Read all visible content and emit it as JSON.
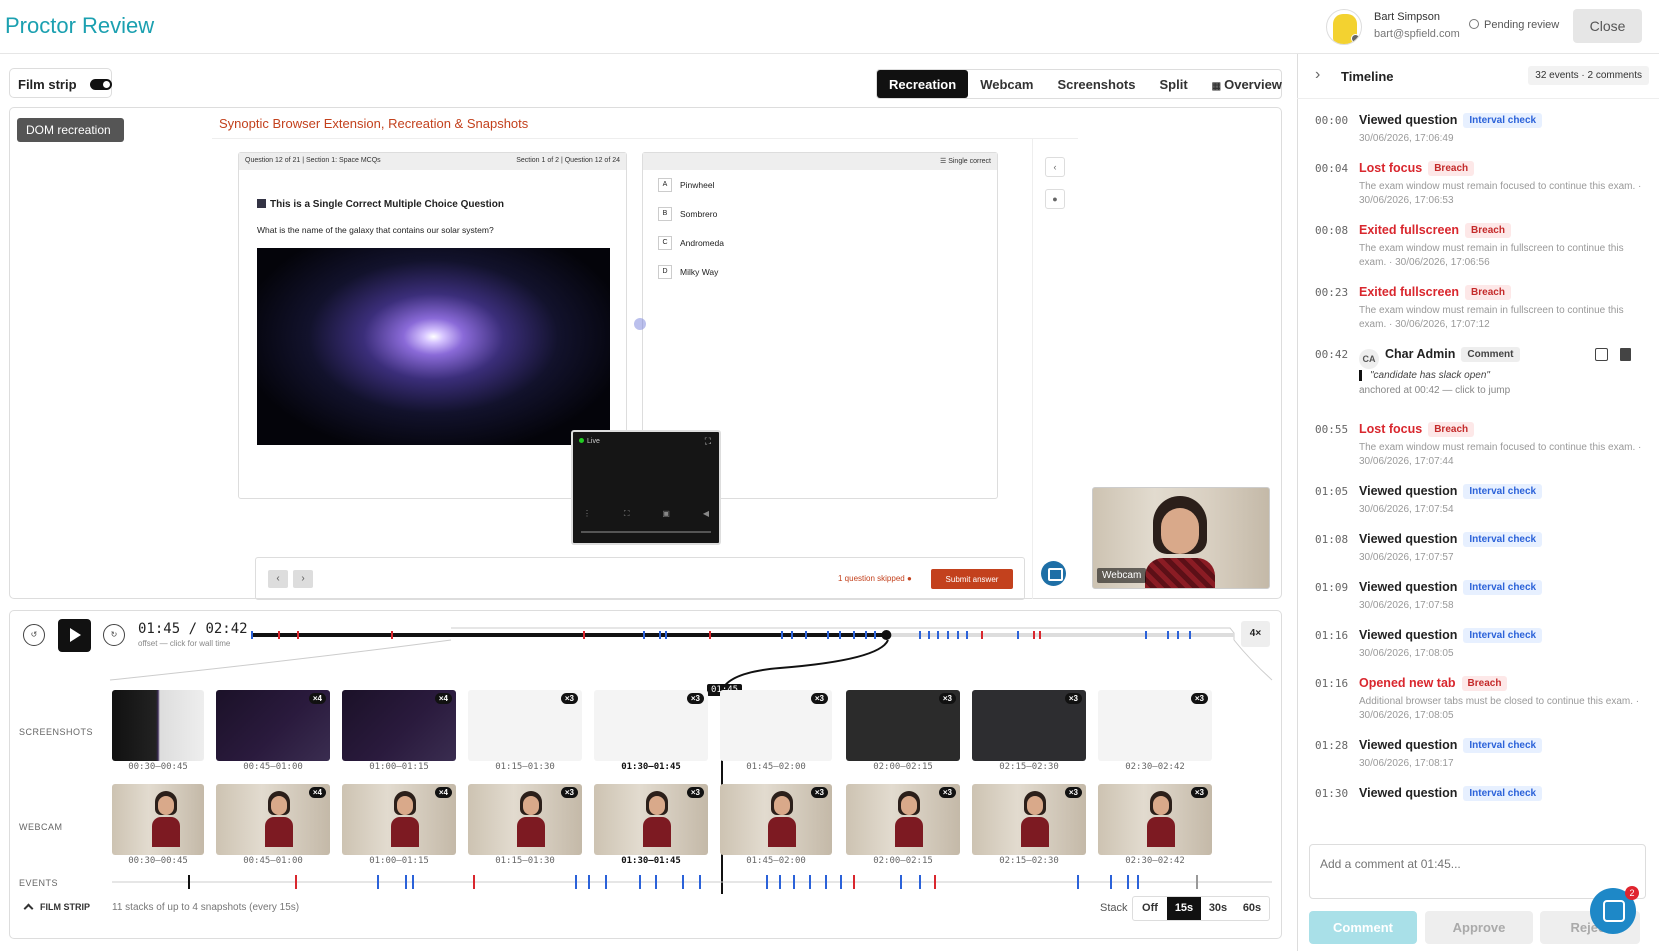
{
  "header": {
    "title": "Proctor Review"
  },
  "user": {
    "name": "Bart Simpson",
    "email": "bart@spfield.com",
    "status": "Pending review",
    "close_label": "Close"
  },
  "toolbar": {
    "film_strip_label": "Film strip"
  },
  "view_tabs": [
    {
      "label": "Recreation",
      "active": true
    },
    {
      "label": "Webcam"
    },
    {
      "label": "Screenshots"
    },
    {
      "label": "Split"
    },
    {
      "label": "Overview"
    }
  ],
  "recreation": {
    "dom_label": "DOM recreation",
    "page_title": "Synoptic Browser Extension, Recreation & Snapshots",
    "question_bar_left": "Question 12 of 21 | Section 1: Space MCQs",
    "question_bar_right": "Section 1 of 2 | Question 12 of 24",
    "question_title": "This is a Single Correct Multiple Choice Question",
    "question_text": "What is the name of the galaxy that contains our solar system?",
    "options_label": "Single correct",
    "options": [
      {
        "letter": "A",
        "label": "Pinwheel"
      },
      {
        "letter": "B",
        "label": "Sombrero"
      },
      {
        "letter": "C",
        "label": "Andromeda"
      },
      {
        "letter": "D",
        "label": "Milky Way"
      }
    ],
    "live_label": "Live",
    "skipped_label": "1 question skipped",
    "submit_label": "Submit answer",
    "webcam_label": "Webcam"
  },
  "player": {
    "current_time": "01:45",
    "total_time": "02:42",
    "offset_hint": "offset — click for wall time",
    "speed": "4×",
    "progress": 0.646,
    "playhead_label": "01:45"
  },
  "film_strip": {
    "screenshots_label": "SCREENSHOTS",
    "webcam_label": "WEBCAM",
    "events_label": "EVENTS",
    "toggle_label": "FILM STRIP",
    "summary": "11 stacks of up to 4 snapshots (every 15s)",
    "stack_label": "Stack",
    "stack_options": [
      {
        "label": "Off"
      },
      {
        "label": "15s",
        "active": true
      },
      {
        "label": "30s"
      },
      {
        "label": "60s"
      }
    ],
    "screenshots": [
      {
        "range": "00:30–00:45",
        "badge": ""
      },
      {
        "range": "00:45–01:00",
        "badge": "×4"
      },
      {
        "range": "01:00–01:15",
        "badge": "×4"
      },
      {
        "range": "01:15–01:30",
        "badge": "×3"
      },
      {
        "range": "01:30–01:45",
        "badge": "×3"
      },
      {
        "range": "01:45–02:00",
        "badge": "×3"
      },
      {
        "range": "02:00–02:15",
        "badge": "×3"
      },
      {
        "range": "02:15–02:30",
        "badge": "×3"
      },
      {
        "range": "02:30–02:42",
        "badge": "×3"
      }
    ],
    "webcam": [
      {
        "range": "00:30–00:45",
        "badge": ""
      },
      {
        "range": "00:45–01:00",
        "badge": "×4"
      },
      {
        "range": "01:00–01:15",
        "badge": "×4"
      },
      {
        "range": "01:15–01:30",
        "badge": "×3"
      },
      {
        "range": "01:30–01:45",
        "badge": "×3"
      },
      {
        "range": "01:45–02:00",
        "badge": "×3"
      },
      {
        "range": "02:00–02:15",
        "badge": "×3"
      },
      {
        "range": "02:15–02:30",
        "badge": "×3"
      },
      {
        "range": "02:30–02:42",
        "badge": "×3"
      }
    ]
  },
  "timeline": {
    "title": "Timeline",
    "count": "32 events · 2 comments",
    "events": [
      {
        "time": "00:00",
        "title": "Viewed question",
        "tag": "Interval check",
        "type": "info",
        "detail": "30/06/2026, 17:06:49"
      },
      {
        "time": "00:04",
        "title": "Lost focus",
        "tag": "Breach",
        "type": "breach",
        "detail": "The exam window must remain focused to continue this exam. · 30/06/2026, 17:06:53"
      },
      {
        "time": "00:08",
        "title": "Exited fullscreen",
        "tag": "Breach",
        "type": "breach",
        "detail": "The exam window must remain in fullscreen to continue this exam. · 30/06/2026, 17:06:56"
      },
      {
        "time": "00:23",
        "title": "Exited fullscreen",
        "tag": "Breach",
        "type": "breach",
        "detail": "The exam window must remain in fullscreen to continue this exam. · 30/06/2026, 17:07:12"
      },
      {
        "time": "00:42",
        "title": "Char Admin",
        "initials": "CA",
        "tag": "Comment",
        "type": "comment",
        "quote": "\"candidate has slack open\"",
        "anchor": "anchored at 00:42 — click to jump"
      },
      {
        "time": "00:55",
        "title": "Lost focus",
        "tag": "Breach",
        "type": "breach",
        "detail": "The exam window must remain focused to continue this exam. · 30/06/2026, 17:07:44"
      },
      {
        "time": "01:05",
        "title": "Viewed question",
        "tag": "Interval check",
        "type": "info",
        "detail": "30/06/2026, 17:07:54"
      },
      {
        "time": "01:08",
        "title": "Viewed question",
        "tag": "Interval check",
        "type": "info",
        "detail": "30/06/2026, 17:07:57"
      },
      {
        "time": "01:09",
        "title": "Viewed question",
        "tag": "Interval check",
        "type": "info",
        "detail": "30/06/2026, 17:07:58"
      },
      {
        "time": "01:16",
        "title": "Viewed question",
        "tag": "Interval check",
        "type": "info",
        "detail": "30/06/2026, 17:08:05"
      },
      {
        "time": "01:16",
        "title": "Opened new tab",
        "tag": "Breach",
        "type": "breach",
        "detail": "Additional browser tabs must be closed to continue this exam. · 30/06/2026, 17:08:05"
      },
      {
        "time": "01:28",
        "title": "Viewed question",
        "tag": "Interval check",
        "type": "info",
        "detail": "30/06/2026, 17:08:17"
      },
      {
        "time": "01:30",
        "title": "Viewed question",
        "tag": "Interval check",
        "type": "info",
        "detail": ""
      }
    ]
  },
  "comment_box": {
    "placeholder": "Add a comment at 01:45...",
    "comment_label": "Comment",
    "approve_label": "Approve",
    "reject_label": "Reject"
  },
  "help": {
    "badge": "2"
  },
  "colors": {
    "brand": "#1ba0b0",
    "breach": "#d9272e",
    "info": "#2b62d9",
    "submit": "#c3411d"
  }
}
